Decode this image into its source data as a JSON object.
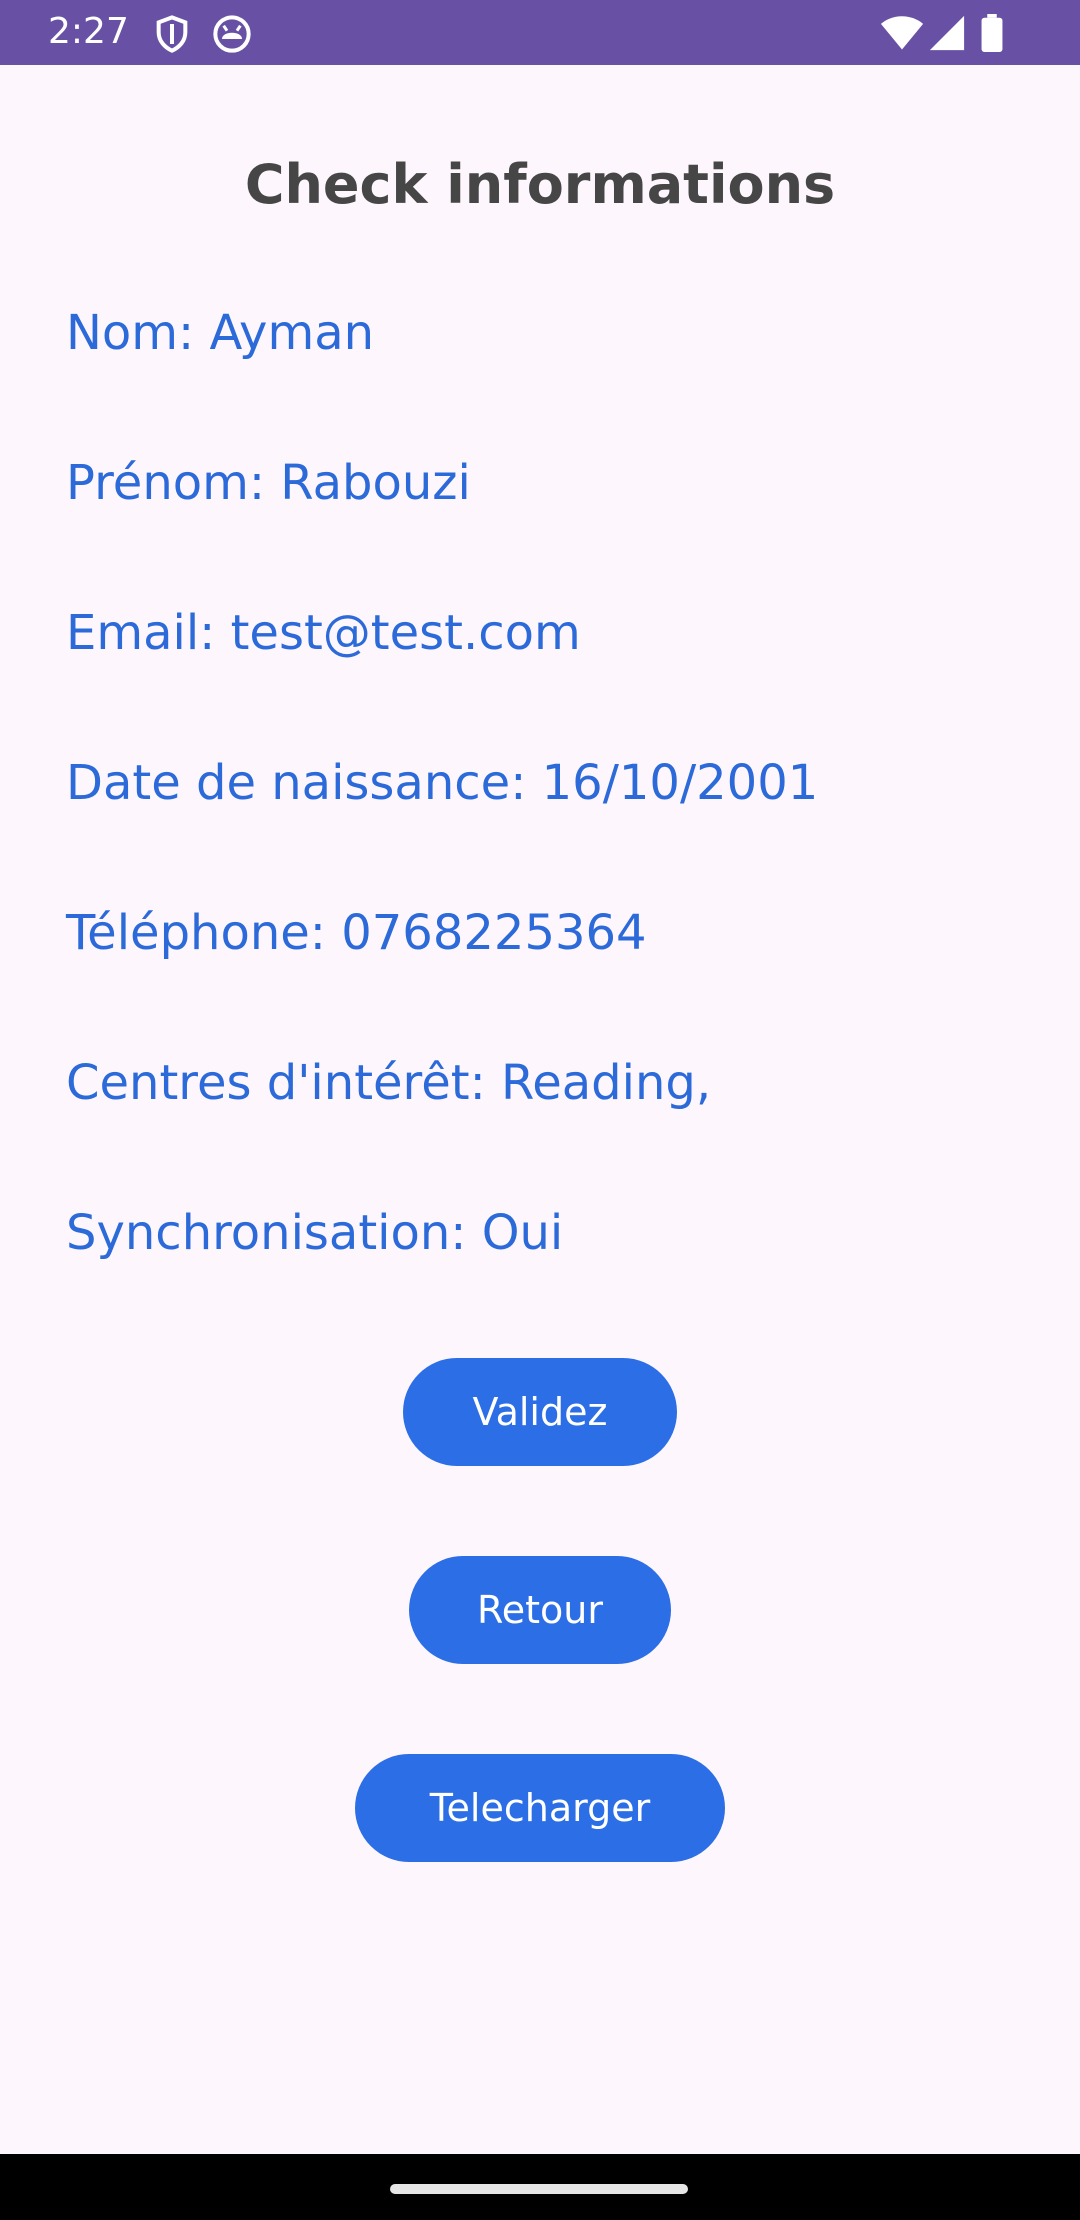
{
  "status_bar": {
    "time": "2:27",
    "icons_left": [
      "shield-icon",
      "android-head-icon"
    ],
    "icons_right": [
      "wifi-icon",
      "cell-signal-icon",
      "battery-icon"
    ],
    "background_color": "#6851a5"
  },
  "page": {
    "title": "Check informations",
    "background_color": "#fdf6fc",
    "text_color": "#2b6ad8"
  },
  "info": [
    {
      "label": "Nom: Ayman"
    },
    {
      "label": "Prénom: Rabouzi"
    },
    {
      "label": "Email: test@test.com"
    },
    {
      "label": "Date de naissance: 16/10/2001"
    },
    {
      "label": "Téléphone: 0768225364"
    },
    {
      "label": "Centres d'intérêt: Reading,"
    },
    {
      "label": "Synchronisation: Oui"
    }
  ],
  "buttons": {
    "validate_label": "Validez",
    "back_label": "Retour",
    "download_label": "Telecharger",
    "color": "#2b6ee6"
  }
}
